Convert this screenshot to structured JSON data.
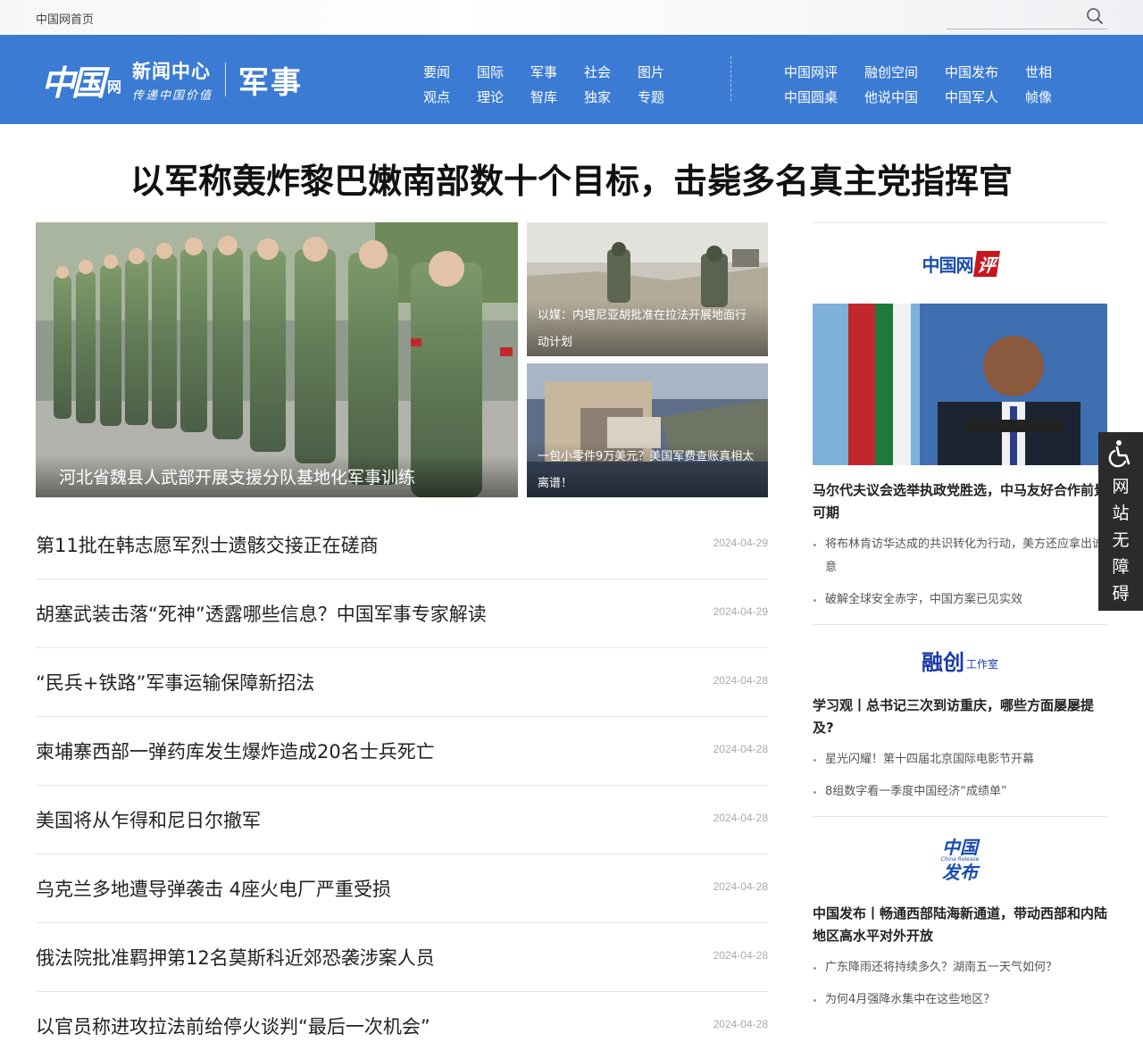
{
  "topbar": {
    "home_link": "中国网首页",
    "search_placeholder": "",
    "search_icon": "search-icon"
  },
  "header": {
    "logo_mark": "中国",
    "logo_wang": "网",
    "logo_center_title": "新闻中心",
    "logo_center_slogan": "传递中国价值",
    "section_title": "军事",
    "background_color": "#3b7bd4",
    "nav_left": [
      "要闻",
      "观点",
      "国际",
      "理论",
      "军事",
      "智库",
      "社会",
      "独家",
      "图片",
      "专题"
    ],
    "nav_right": [
      "中国网评",
      "中国圆桌",
      "融创空间",
      "他说中国",
      "中国发布",
      "中国军人",
      "世相",
      "帧像"
    ]
  },
  "headline": "以军称轰炸黎巴嫩南部数十个目标，击毙多名真主党指挥官",
  "hero": {
    "main_caption": "河北省魏县人武部开展支援分队基地化军事训练",
    "side1_caption": "以媒：内塔尼亚胡批准在拉法开展地面行动计划",
    "side2_caption": "一包小零件9万美元？美国军费查账真相太离谱！"
  },
  "news": [
    {
      "title": "第11批在韩志愿军烈士遗骸交接正在磋商",
      "date": "2024-04-29"
    },
    {
      "title": "胡塞武装击落“死神”透露哪些信息？中国军事专家解读",
      "date": "2024-04-29"
    },
    {
      "title": "“民兵+铁路”军事运输保障新招法",
      "date": "2024-04-28"
    },
    {
      "title": "柬埔寨西部一弹药库发生爆炸造成20名士兵死亡",
      "date": "2024-04-28"
    },
    {
      "title": "美国将从乍得和尼日尔撤军",
      "date": "2024-04-28"
    },
    {
      "title": "乌克兰多地遭导弹袭击 4座火电厂严重受损",
      "date": "2024-04-28"
    },
    {
      "title": "俄法院批准羁押第12名莫斯科近郊恐袭涉案人员",
      "date": "2024-04-28"
    },
    {
      "title": "以官员称进攻拉法前给停火谈判“最后一次机会”",
      "date": "2024-04-28"
    }
  ],
  "sidebar": {
    "review": {
      "logo_cn": "中国网",
      "logo_ping": "评",
      "title": "马尔代夫议会选举执政党胜选，中马友好合作前景可期",
      "items": [
        "将布林肯访华达成的共识转化为行动，美方还应拿出诚意",
        "破解全球安全赤字，中国方案已见实效"
      ]
    },
    "rongchuang": {
      "logo_big": "融创",
      "logo_small": "工作室",
      "title": "学习观丨总书记三次到访重庆，哪些方面屡屡提及?",
      "items": [
        "星光闪耀！第十四届北京国际电影节开幕",
        "8组数字看一季度中国经济“成绩单”"
      ]
    },
    "fabu": {
      "logo_top": "中国",
      "logo_mid": "China Release",
      "logo_bottom": "发布",
      "title": "中国发布丨畅通西部陆海新通道，带动西部和内陆地区高水平对外开放",
      "items": [
        "广东降雨还将持续多久？湖南五一天气如何？",
        "为何4月强降水集中在这些地区？"
      ]
    }
  },
  "accessibility": {
    "label": "网站无障碍",
    "icon": "wheelchair-icon"
  }
}
